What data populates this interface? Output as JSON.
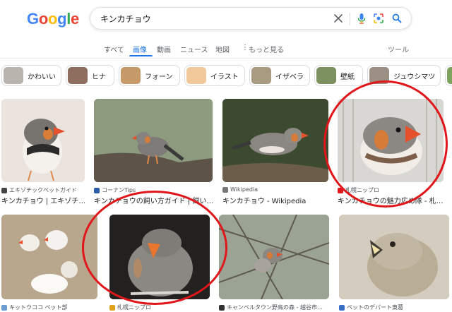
{
  "logo": {
    "letters": [
      "G",
      "o",
      "o",
      "g",
      "l",
      "e"
    ],
    "colors": [
      "#4285f4",
      "#ea4335",
      "#fbbc05",
      "#4285f4",
      "#34a853",
      "#ea4335"
    ]
  },
  "search": {
    "query": "キンカチョウ"
  },
  "icons": {
    "clear": "close-icon",
    "voice": "microphone-icon",
    "lens": "camera-icon",
    "search": "search-icon"
  },
  "tabs": [
    {
      "label": "すべて",
      "active": false
    },
    {
      "label": "画像",
      "active": true
    },
    {
      "label": "動画",
      "active": false
    },
    {
      "label": "ニュース",
      "active": false
    },
    {
      "label": "地図",
      "active": false
    },
    {
      "label": "もっと見る",
      "active": false
    }
  ],
  "tools_label": "ツール",
  "chips": [
    {
      "label": "かわいい",
      "color": "#b9b4ad"
    },
    {
      "label": "ヒナ",
      "color": "#8e6f5f"
    },
    {
      "label": "フォーン",
      "color": "#c59a68"
    },
    {
      "label": "イラスト",
      "color": "#f0c89a"
    },
    {
      "label": "イザベラ",
      "color": "#a89b82"
    },
    {
      "label": "壁紙",
      "color": "#7d9160"
    },
    {
      "label": "ジュウシマツ",
      "color": "#9c8f84"
    },
    {
      "label": "",
      "color": "#7da35d"
    }
  ],
  "results": [
    {
      "source": "エキゾチックペットガイド",
      "title": "キンカチョウ | エキゾチ…",
      "bg": "#ebe4de"
    },
    {
      "source": "コーナンTips",
      "title": "キンカチョウの飼い方ガイド | 飼い…",
      "bg": "#7b8a6f"
    },
    {
      "source": "Wikipedia",
      "title": "キンカチョウ - Wikipedia",
      "bg": "#35402c"
    },
    {
      "source": "札幌ニップロ",
      "title": "キンカチョウの魅力広め隊 - 札…",
      "bg": "#d8d6d2"
    },
    {
      "source": "キットウココ ペット部",
      "title": "",
      "bg": "#bba78d"
    },
    {
      "source": "札幌ニップロ",
      "title": "",
      "bg": "#1f1e1c"
    },
    {
      "source": "キャンベルタウン野鳥の森 - 越谷市…",
      "title": "",
      "bg": "#8f9a86"
    },
    {
      "source": "ペットのデパート東葛",
      "title": "",
      "bg": "#cfc6b7"
    }
  ],
  "annotation": {
    "color": "#e0161b"
  }
}
